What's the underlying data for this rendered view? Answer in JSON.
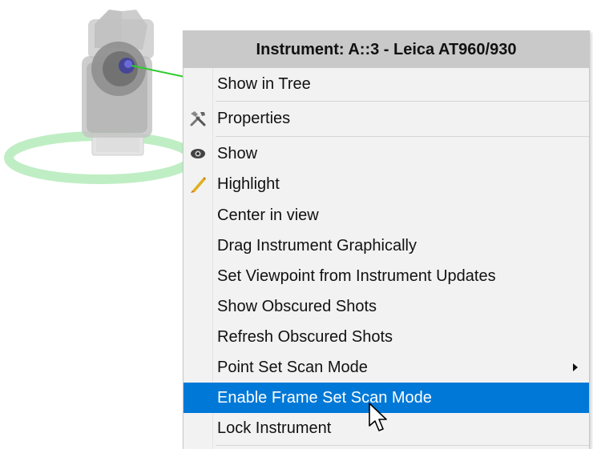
{
  "menu": {
    "title": "Instrument: A::3 - Leica AT960/930",
    "items": [
      {
        "label": "Show in Tree",
        "icon": ""
      },
      {
        "label": "Properties",
        "icon": "tools-icon"
      },
      {
        "label": "Show",
        "icon": "eye-icon"
      },
      {
        "label": "Highlight",
        "icon": "pencil-icon"
      },
      {
        "label": "Center in view",
        "icon": ""
      },
      {
        "label": "Drag Instrument Graphically",
        "icon": ""
      },
      {
        "label": "Set Viewpoint from Instrument Updates",
        "icon": ""
      },
      {
        "label": "Show Obscured Shots",
        "icon": ""
      },
      {
        "label": "Refresh Obscured Shots",
        "icon": ""
      },
      {
        "label": "Point Set Scan Mode",
        "icon": "",
        "has_submenu": true
      },
      {
        "label": "Enable Frame Set Scan Mode",
        "icon": "",
        "highlighted": true
      },
      {
        "label": "Lock Instrument",
        "icon": ""
      }
    ]
  },
  "colors": {
    "highlight": "#0078d7",
    "header_bg": "#c9c9c9",
    "menu_bg": "#f2f2f2",
    "ring": "#bfeec4"
  }
}
